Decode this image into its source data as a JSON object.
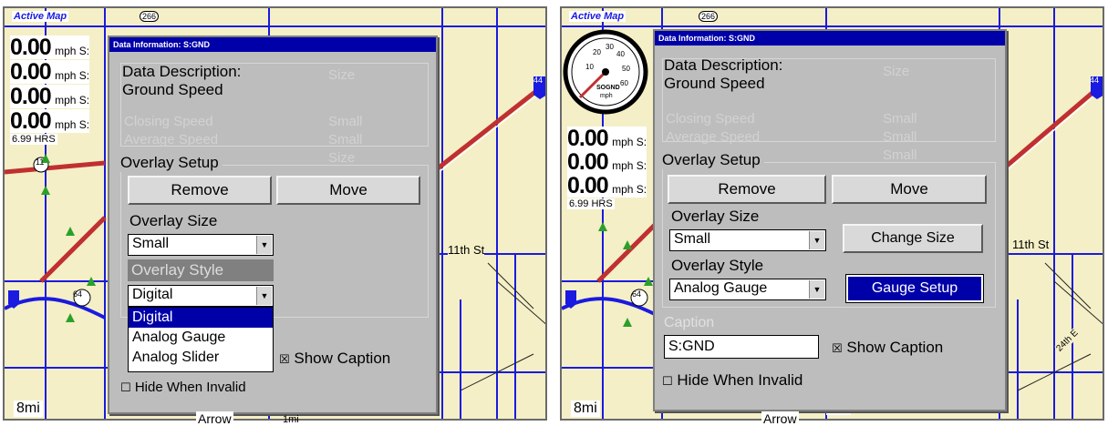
{
  "map": {
    "active_map_label": "Active Map",
    "highway_shields": [
      "266",
      "11",
      "64",
      "44"
    ],
    "street_labels": [
      "11th St",
      "24th E",
      "Arrow"
    ],
    "scale": "8mi",
    "scale_right": "1mi"
  },
  "left": {
    "readouts": [
      {
        "value": "0.00",
        "unit": "mph S:"
      },
      {
        "value": "0.00",
        "unit": "mph S:"
      },
      {
        "value": "0.00",
        "unit": "mph S:"
      },
      {
        "value": "0.00",
        "unit": "mph S:"
      }
    ],
    "hrs": "6.99 HRS",
    "dialog": {
      "title": "Data Information: S:GND",
      "description_label": "Data Description:",
      "description_value": "Ground Speed",
      "ghost_rows": [
        {
          "name": "Closing Speed",
          "size": "Small"
        },
        {
          "name": "Average Speed",
          "size": "Small"
        },
        {
          "name": "",
          "size": "Size"
        }
      ],
      "ghost_header": "Size",
      "overlay_setup_label": "Overlay Setup",
      "remove_label": "Remove",
      "move_label": "Move",
      "overlay_size_label": "Overlay Size",
      "overlay_size_value": "Small",
      "overlay_style_label": "Overlay Style",
      "overlay_style_value": "Digital",
      "style_options": [
        "Digital",
        "Analog Gauge",
        "Analog Slider"
      ],
      "show_caption_label": "Show Caption",
      "hide_invalid_label": "Hide When Invalid"
    }
  },
  "right": {
    "readouts": [
      {
        "value": "0.00",
        "unit": "mph S:"
      },
      {
        "value": "0.00",
        "unit": "mph S:"
      },
      {
        "value": "0.00",
        "unit": "mph S:"
      }
    ],
    "hrs": "6.99 HRS",
    "gauge": {
      "label": "SOGND",
      "unit": "mph",
      "ticks": [
        "10",
        "20",
        "30",
        "40",
        "50",
        "60"
      ]
    },
    "dialog": {
      "title": "Data Information: S:GND",
      "description_label": "Data Description:",
      "description_value": "Ground Speed",
      "ghost_rows": [
        {
          "name": "Closing Speed",
          "size": "Small"
        },
        {
          "name": "Average Speed",
          "size": "Small"
        },
        {
          "name": "",
          "size": "Small"
        }
      ],
      "ghost_header": "Size",
      "overlay_setup_label": "Overlay Setup",
      "remove_label": "Remove",
      "move_label": "Move",
      "overlay_size_label": "Overlay Size",
      "overlay_size_value": "Small",
      "change_size_label": "Change Size",
      "overlay_style_label": "Overlay Style",
      "overlay_style_value": "Analog Gauge",
      "gauge_setup_label": "Gauge Setup",
      "caption_label": "Caption",
      "caption_value": "S:GND",
      "show_caption_label": "Show Caption",
      "hide_invalid_label": "Hide When Invalid"
    }
  },
  "colors": {
    "map_bg": "#f4efc6",
    "road_blue": "#1a1ae0",
    "road_red": "#c03030",
    "titlebar": "#0000a8",
    "dialog_bg": "#bdbdbd"
  }
}
